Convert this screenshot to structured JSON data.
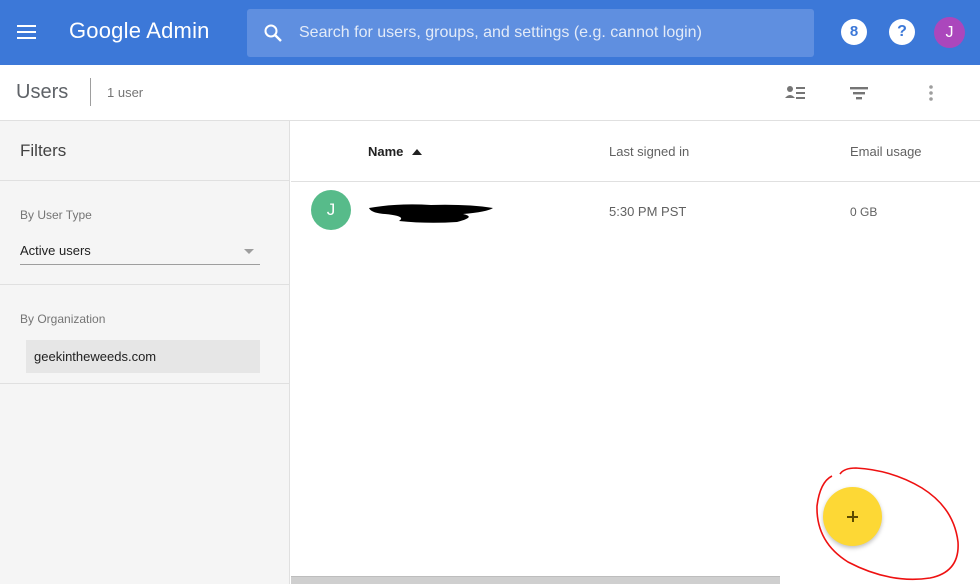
{
  "app": {
    "brand": "Google Admin",
    "avatar_letter": "J",
    "avatar_color": "#ab47bc",
    "bar_color": "#3c78d8"
  },
  "search": {
    "placeholder": "Search for users, groups, and settings (e.g. cannot login)"
  },
  "top_icons": {
    "hourglass": "8",
    "help": "?"
  },
  "toolbar": {
    "title": "Users",
    "count": "1 user"
  },
  "filters": {
    "title": "Filters",
    "user_type_label": "By User Type",
    "user_type_value": "Active users",
    "org_label": "By Organization",
    "org_value": "geekintheweeds.com"
  },
  "table": {
    "columns": {
      "name": "Name",
      "last_signed_in": "Last signed in",
      "email_usage": "Email usage"
    },
    "rows": [
      {
        "avatar": "J",
        "avatar_color": "#57bb8a",
        "last_signed_in": "5:30 PM PST",
        "email_usage": "0 GB"
      }
    ]
  },
  "fab": {
    "icon": "plus-icon",
    "color": "#fdd835"
  }
}
